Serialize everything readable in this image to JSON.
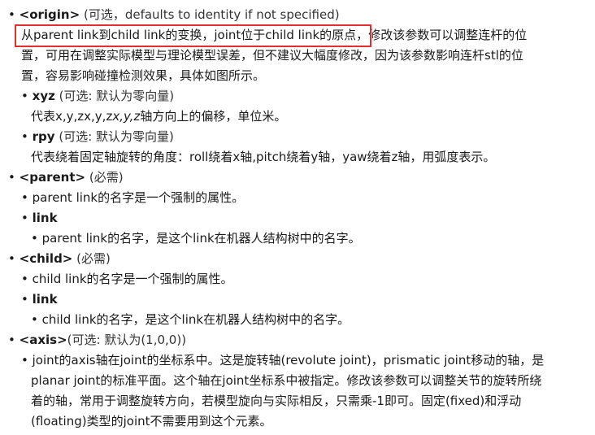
{
  "origin": {
    "tag": "<origin>",
    "note": "(可选，defaults to identity if not specified)",
    "desc_highlight": "从parent link到child link的变换，joint位于child link的原点，",
    "desc_rest1": "修改该参数可以调整连杆的位",
    "desc_line2": "置，可用在调整实际模型与理论模型误差，但不建议大幅度修改，因为该参数影响连杆stl的位",
    "desc_line3": "置，容易影响碰撞检测效果，具体如图所示。",
    "xyz": {
      "name": "xyz",
      "note": "(可选: 默认为零向量)",
      "desc_a": "代表x,y,zx,y,z",
      "desc_b": "x,y,z",
      "desc_c": "轴方向上的偏移，单位米。"
    },
    "rpy": {
      "name": "rpy",
      "note": "(可选: 默认为零向量)",
      "desc": "代表绕着固定轴旋转的角度：roll绕着x轴,pitch绕着y轴，yaw绕着z轴，用弧度表示。"
    }
  },
  "parent": {
    "tag": "<parent>",
    "note": "(必需)",
    "desc": "parent link的名字是一个强制的属性。",
    "link_name": "link",
    "link_desc": "parent link的名字，是这个link在机器人结构树中的名字。"
  },
  "child": {
    "tag": "<child>",
    "note": "(必需)",
    "desc": "child link的名字是一个强制的属性。",
    "link_name": "link",
    "link_desc": "child link的名字，是这个link在机器人结构树中的名字。"
  },
  "axis": {
    "tag": "<axis>",
    "note": "(可选: 默认为(1,0,0))",
    "line1": "joint的axis轴在joint的坐标系中。这是旋转轴(revolute joint)，prismatic joint移动的轴，是",
    "line2": "planar joint的标准平面。这个轴在joint坐标系中被指定。修改该参数可以调整关节的旋转所绕",
    "line3": "着的轴，常用于调整旋转方向，若模型旋向与实际相反，只需乘-1即可。固定(fixed)和浮动",
    "line4": "(floating)类型的joint不需要用到这个元素。"
  },
  "bullet": "•"
}
